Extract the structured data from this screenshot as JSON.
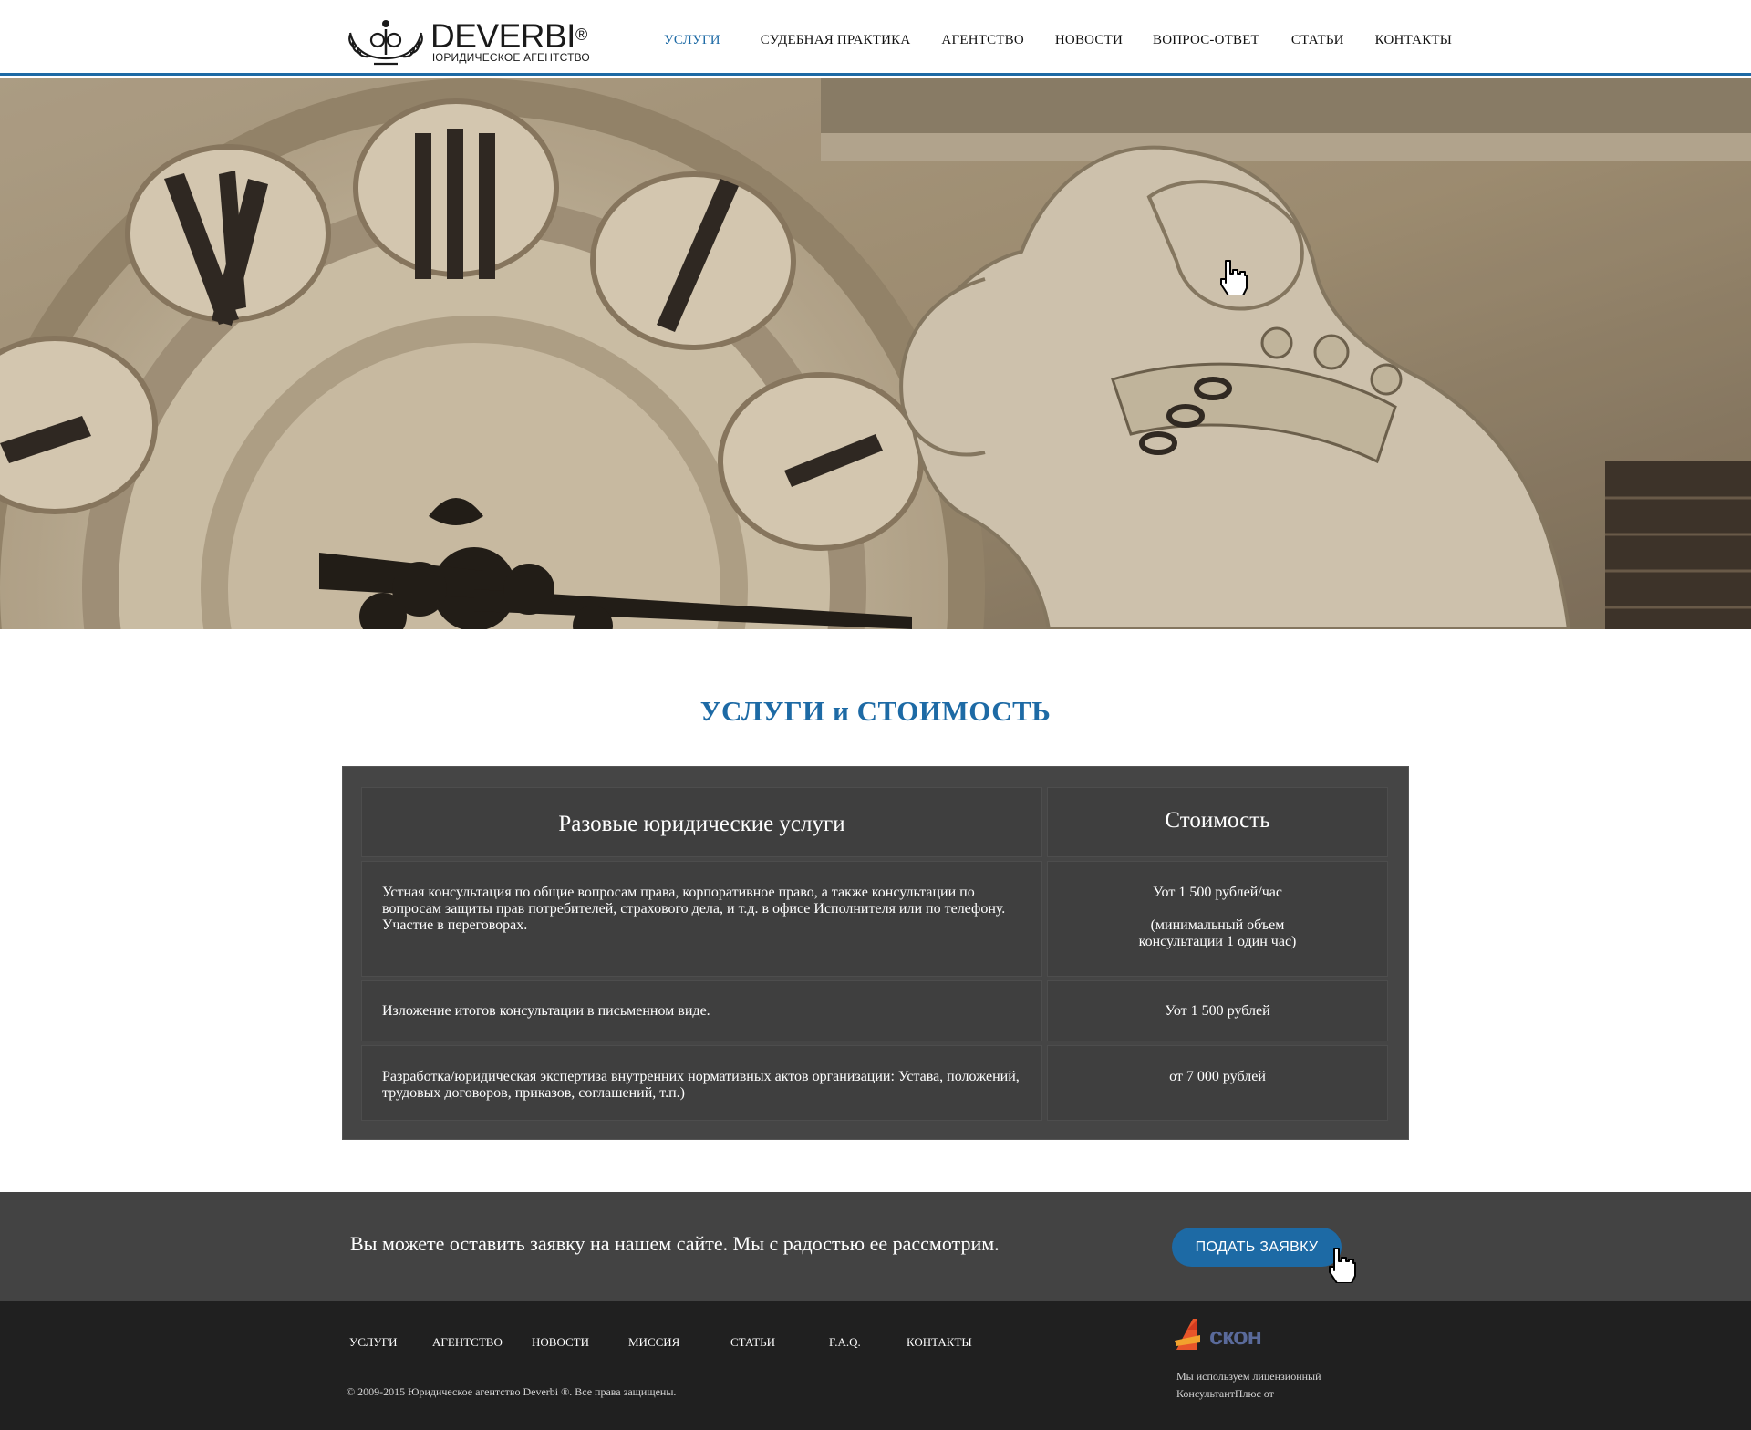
{
  "header": {
    "logo_name": "DEVERBI",
    "logo_registered": "®",
    "logo_subtitle": "ЮРИДИЧЕСКОЕ АГЕНТСТВО",
    "nav": [
      {
        "label": "УСЛУГИ",
        "active": true
      },
      {
        "label": "СУДЕБНАЯ ПРАКТИКА",
        "active": false
      },
      {
        "label": "АГЕНТСТВО",
        "active": false
      },
      {
        "label": "НОВОСТИ",
        "active": false
      },
      {
        "label": "ВОПРОС-ОТВЕТ",
        "active": false
      },
      {
        "label": "СТАТЬИ",
        "active": false
      },
      {
        "label": "КОНТАКТЫ",
        "active": false
      }
    ]
  },
  "hero": {
    "image_icon": "clock-and-horse-sculpture-photo"
  },
  "services": {
    "title": "УСЛУГИ и СТОИМОСТЬ",
    "header_service": "Разовые юридические услуги",
    "header_price": "Стоимость",
    "rows": [
      {
        "service": "Устная консультация по общие вопросам права, корпоративное право, а также консультации по вопросам защиты прав потребителей, страхового дела, и т.д. в офисе Исполнителя или по телефону. Участие в переговорах.",
        "price": "Уот 1 500 рублей/час",
        "price_note": "(минимальный  объем консультации 1 один час)"
      },
      {
        "service": "Изложение итогов консультации в письменном виде.",
        "price": "Уот 1 500 рублей",
        "price_note": ""
      },
      {
        "service": "Разработка/юридическая экспертиза внутренних нормативных актов организации: Устава, положений, трудовых договоров, приказов, соглашений,  т.п.)",
        "price": "от 7 000 рублей",
        "price_note": ""
      }
    ]
  },
  "callout": {
    "text": "Вы можете оставить заявку на нашем сайте. Мы с радостью ее рассмотрим.",
    "button": "ПОДАТЬ ЗАЯВКУ"
  },
  "footer": {
    "nav": [
      "УСЛУГИ",
      "АГЕНТСТВО",
      "НОВОСТИ",
      "МИССИЯ",
      "СТАТЬИ",
      "F.A.Q.",
      "КОНТАКТЫ"
    ],
    "copyright": "© 2009-2015 Юридическое агентство Deverbi ®. Все права защищены.",
    "partner_logo": "скон",
    "partner_note": "Мы используем лицензионный КонсультантПлюс от"
  },
  "colors": {
    "accent": "#1d6aa5",
    "table_bg": "#454545",
    "callout_bg": "#434343",
    "footer_bg": "#202020"
  }
}
